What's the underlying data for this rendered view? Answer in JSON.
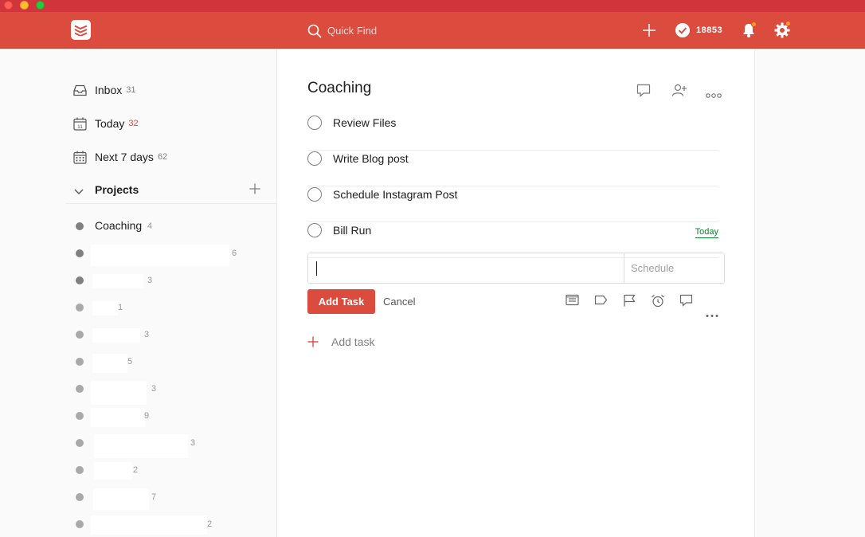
{
  "topbar": {
    "search_placeholder": "Quick Find",
    "karma_count": "18853"
  },
  "sidebar": {
    "nav": [
      {
        "label": "Inbox",
        "count": "31"
      },
      {
        "label": "Today",
        "count": "32"
      },
      {
        "label": "Next 7 days",
        "count": "62"
      }
    ],
    "projects_title": "Projects",
    "projects": [
      {
        "name": "Coaching",
        "count": "4"
      },
      {
        "name": "",
        "count": "6"
      },
      {
        "name": "",
        "count": "3"
      },
      {
        "name": "",
        "count": "1"
      },
      {
        "name": "",
        "count": "3"
      },
      {
        "name": "",
        "count": "5"
      },
      {
        "name": "",
        "count": "3"
      },
      {
        "name": "",
        "count": "9"
      },
      {
        "name": "",
        "count": "3"
      },
      {
        "name": "",
        "count": "2"
      },
      {
        "name": "",
        "count": "7"
      },
      {
        "name": "",
        "count": "2"
      }
    ]
  },
  "main": {
    "project_title": "Coaching",
    "tasks": [
      {
        "label": "Review Files",
        "due": ""
      },
      {
        "label": "Write Blog post",
        "due": ""
      },
      {
        "label": "Schedule Instagram Post",
        "due": ""
      },
      {
        "label": "Bill Run",
        "due": "Today"
      }
    ],
    "editor": {
      "value": "",
      "schedule_placeholder": "Schedule",
      "add_label": "Add Task",
      "cancel_label": "Cancel"
    },
    "add_task_label": "Add task"
  },
  "colors": {
    "brand": "#db4c3f",
    "today_count": "#db4c3f",
    "due_today": "#058527",
    "notification_dot": "#ff9a14"
  },
  "icons": {
    "logo": "todoist-logo-icon",
    "search": "search-icon",
    "add": "plus-icon",
    "karma": "check-circle-icon",
    "notifications": "bell-icon",
    "settings": "gear-icon"
  }
}
